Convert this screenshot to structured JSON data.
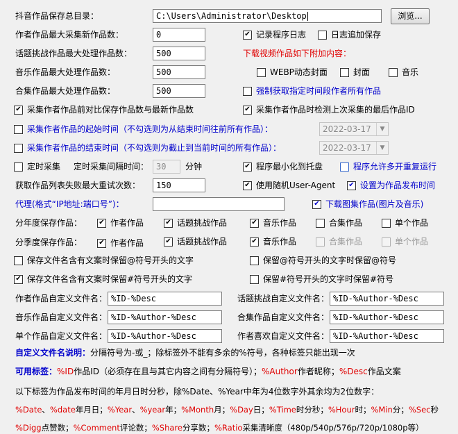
{
  "save_dir": {
    "label": "抖音作品保存总目录：",
    "value": "C:\\Users\\Administrator\\Desktop",
    "browse": "浏览..."
  },
  "fields": {
    "max_new_author": {
      "label": "作者作品最大采集新作品数：",
      "value": "0"
    },
    "max_challenge": {
      "label": "话题挑战作品最大处理作品数：",
      "value": "500"
    },
    "max_music": {
      "label": "音乐作品最大处理作品数：",
      "value": "500"
    },
    "max_collection": {
      "label": "合集作品最大处理作品数：",
      "value": "500"
    },
    "retry": {
      "label": "获取作品列表失败最大重试次数：",
      "value": "150"
    },
    "proxy": {
      "label": "代理(格式“IP地址:端口号”)：",
      "value": ""
    }
  },
  "checks": {
    "log": {
      "label": "记录程序日志",
      "checked": true
    },
    "log_append": {
      "label": "日志追加保存",
      "checked": false
    },
    "download_extra_title": "下载视频作品如下附加内容：",
    "webp": {
      "label": "WEBP动态封面",
      "checked": false
    },
    "cover": {
      "label": "封面",
      "checked": false
    },
    "music": {
      "label": "音乐",
      "checked": false
    },
    "force_time": {
      "label": "强制获取指定时间段作者所有作品",
      "checked": false
    },
    "compare_saved": {
      "label": "采集作者作品前对比保存作品数与最新作品数",
      "checked": true
    },
    "detect_last": {
      "label": "采集作者作品时检测上次采集的最后作品ID",
      "checked": true
    },
    "start_time": {
      "label": "采集作者作品的起始时间（不勾选则为从结束时间往前所有作品）：",
      "checked": false,
      "date": "2022-03-17"
    },
    "end_time": {
      "label": "采集作者作品的结束时间（不勾选则为截止到当前时间的所有作品）：",
      "checked": false,
      "date": "2022-03-17"
    },
    "timed": {
      "label": "定时采集",
      "checked": false
    },
    "interval_label": "定时采集间隔时间：",
    "interval_value": "30",
    "interval_unit": "分钟",
    "min_tray": {
      "label": "程序最小化到托盘",
      "checked": true
    },
    "multi_open": {
      "label": "程序允许多开重复运行",
      "checked": false
    },
    "random_ua": {
      "label": "使用随机User-Agent",
      "checked": true
    },
    "set_pubtime": {
      "label": "设置为作品发布时间",
      "checked": true
    },
    "download_images": {
      "label": "下载图集作品(图片及音乐)",
      "checked": true
    }
  },
  "by_year": {
    "label": "分年度保存作品：",
    "items": [
      {
        "label": "作者作品",
        "checked": true
      },
      {
        "label": "话题挑战作品",
        "checked": true
      },
      {
        "label": "音乐作品",
        "checked": true
      },
      {
        "label": "合集作品",
        "checked": false
      },
      {
        "label": "单个作品",
        "checked": false
      }
    ]
  },
  "by_quarter": {
    "label": "分季度保存作品：",
    "items": [
      {
        "label": "作者作品",
        "checked": true
      },
      {
        "label": "话题挑战作品",
        "checked": true
      },
      {
        "label": "音乐作品",
        "checked": true
      },
      {
        "label": "合集作品",
        "checked": false
      },
      {
        "label": "单个作品",
        "checked": false
      }
    ]
  },
  "keep": {
    "at_filename": {
      "label": "保存文件名含有文案时保留@符号开头的文字",
      "checked": false
    },
    "at_keep": {
      "label": "保留@符号开头的文字时保留@符号",
      "checked": false
    },
    "hash_filename": {
      "label": "保存文件名含有文案时保留#符号开头的文字",
      "checked": true
    },
    "hash_keep": {
      "label": "保留#符号开头的文字时保留#符号",
      "checked": false
    }
  },
  "names": {
    "author": {
      "label": "作者作品自定义文件名：",
      "value": "%ID-%Desc"
    },
    "challenge": {
      "label": "话题挑战自定义文件名：",
      "value": "%ID-%Author-%Desc"
    },
    "music": {
      "label": "音乐作品自定义文件名：",
      "value": "%ID-%Author-%Desc"
    },
    "collection": {
      "label": "合集作品自定义文件名：",
      "value": "%ID-%Author-%Desc"
    },
    "single": {
      "label": "单个作品自定义文件名：",
      "value": "%ID-%Author-%Desc"
    },
    "liked": {
      "label": "作者喜欢自定义文件名：",
      "value": "%ID-%Author-%Desc"
    }
  },
  "help": {
    "title": "自定义文件名说明：",
    "line1": "分隔符号为-或_；除标签外不能有多余的%符号，各种标签只能出现一次",
    "tags_title": "可用标签：",
    "tag_id": "%ID",
    "tag_id_text": "作品ID（必须存在且与其它内容之间有分隔符号）；",
    "tag_author": "%Author",
    "tag_author_text": "作者昵称；",
    "tag_desc": "%Desc",
    "tag_desc_text": "作品文案",
    "line3": "以下标签为作品发布时间的年月日时分秒，除%Date、%Year中年为4位数字外其余均为2位数字：",
    "l4": [
      "%Date",
      "、",
      "%date",
      "年月日；",
      "%Year",
      "、",
      "%year",
      "年；",
      "%Month",
      "月；",
      "%Day",
      "日；",
      "%Time",
      "时分秒；",
      "%Hour",
      "时；",
      "%Min",
      "分；",
      "%Sec",
      "秒"
    ],
    "l5": [
      "%Digg",
      "点赞数；",
      "%Comment",
      "评论数；",
      "%Share",
      "分享数；",
      "%Ratio",
      "采集清晰度（480p/540p/576p/720p/1080p等）"
    ]
  }
}
